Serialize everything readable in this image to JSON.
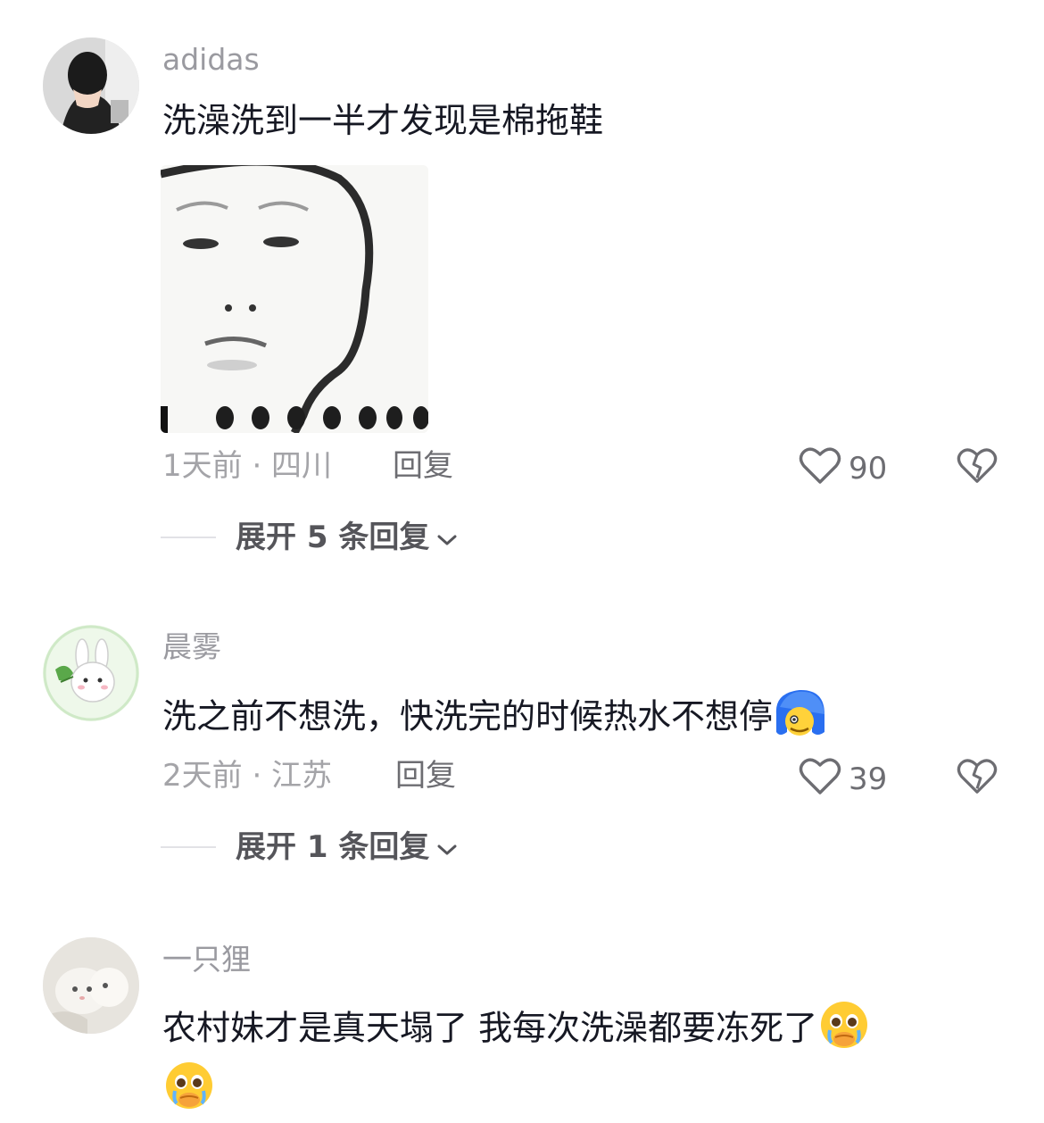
{
  "comments": [
    {
      "username": "adidas",
      "text": "洗澡洗到一半才发现是棉拖鞋",
      "time_location": "1天前 · 四川",
      "reply_label": "回复",
      "likes": "90",
      "expand_label": "展开 5 条回复"
    },
    {
      "username": "晨雾",
      "text": "洗之前不想洗，快洗完的时候热水不想停",
      "time_location": "2天前 · 江苏",
      "reply_label": "回复",
      "likes": "39",
      "expand_label": "展开 1 条回复"
    },
    {
      "username": "一只狸",
      "text": "农村妹才是真天塌了 我每次洗澡都要冻死了"
    }
  ],
  "icons": {
    "like": "heart-outline-icon",
    "dislike": "broken-heart-icon",
    "expand": "chevron-down-icon",
    "crying_emoji": "pleading-crying-face-emoji",
    "blue_emoji": "blue-hair-face-emoji"
  },
  "colors": {
    "text": "#161823",
    "secondary": "#9a9aa0",
    "accent_gray": "#6d6d72"
  }
}
